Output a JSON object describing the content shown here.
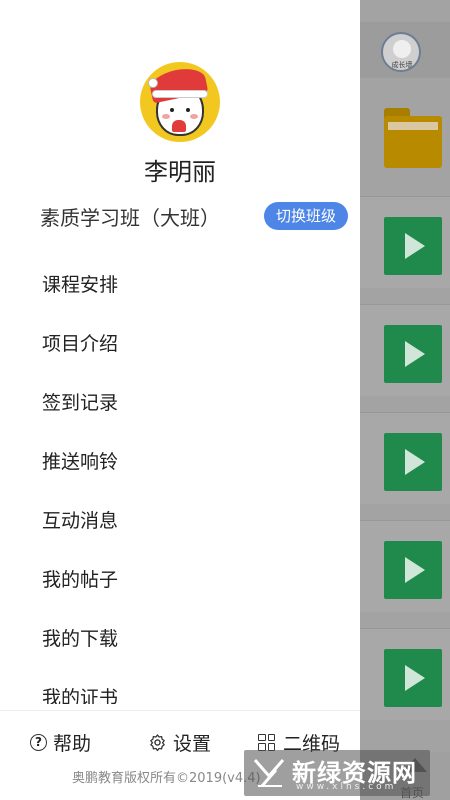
{
  "background_app": {
    "avatar_tag": "成长墙",
    "bottom_tab_label": "首页"
  },
  "drawer": {
    "user_name": "李明丽",
    "class_name": "素质学习班（大班）",
    "switch_class_label": "切换班级",
    "menu_items": [
      "课程安排",
      "项目介绍",
      "签到记录",
      "推送响铃",
      "互动消息",
      "我的帖子",
      "我的下载",
      "我的证书"
    ],
    "bottom": {
      "help_label": "帮助",
      "settings_label": "设置",
      "qrcode_label": "二维码",
      "copyright": "奥鹏教育版权所有©2019(v4.4)"
    }
  },
  "watermark": {
    "text": "新绿资源网",
    "url": "www.xlhs.com"
  },
  "colors": {
    "accent": "#4e86e8",
    "play_green": "#1f8a4c",
    "folder_yellow": "#b88a00"
  }
}
